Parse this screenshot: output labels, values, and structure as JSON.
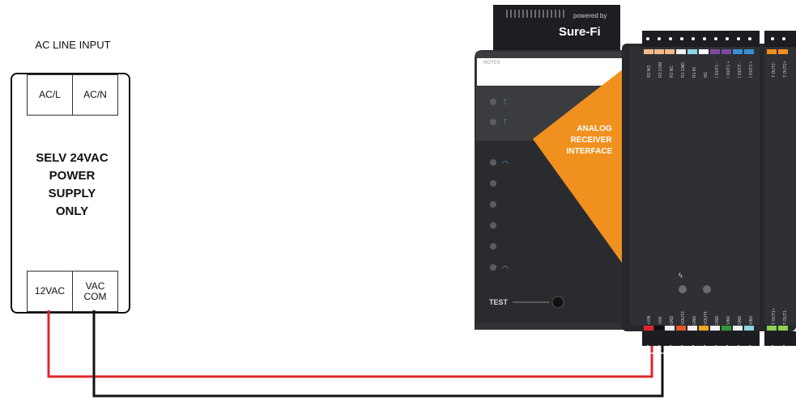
{
  "power_supply": {
    "title": "AC LINE INPUT",
    "top_terminals": [
      "AC/L",
      "AC/N"
    ],
    "body_lines": [
      "SELV 24VAC",
      "POWER",
      "SUPPLY",
      "ONLY"
    ],
    "bottom_terminals": [
      {
        "label": "12VAC"
      },
      {
        "label": "VAC\nCOM",
        "line1": "VAC",
        "line2": "COM"
      }
    ]
  },
  "device": {
    "powered_by": "powered by",
    "brand": "Sure-Fi",
    "notes_label": "NOTES",
    "face_label": [
      "ANALOG",
      "RECEIVER",
      "INTERFACE"
    ],
    "test_label": "TEST",
    "top_pin_labels": [
      "R2 NO",
      "R2 COM",
      "R2 NC",
      "R1 GND",
      "R1 IN",
      "NC",
      "I OUT1 -",
      "I OUT1 +",
      "I OUT2 -",
      "I OUT2 +"
    ],
    "top_right_pin_labels": [
      "T OUT2-",
      "T OUT2+"
    ],
    "bottom_pin_labels": [
      "+VIN",
      "-VIN",
      "GND",
      "VOUT3",
      "GND",
      "VOUT4",
      "GND",
      "VIN1",
      "GND",
      "VIN2"
    ],
    "bottom_right_pin_labels": [
      "T OUT1+",
      "T OUT1-"
    ]
  },
  "colors": {
    "positive_wire": "#e0262a",
    "common_wire": "#111111",
    "device_orange": "#f0901e",
    "device_body": "#2b2d31"
  }
}
